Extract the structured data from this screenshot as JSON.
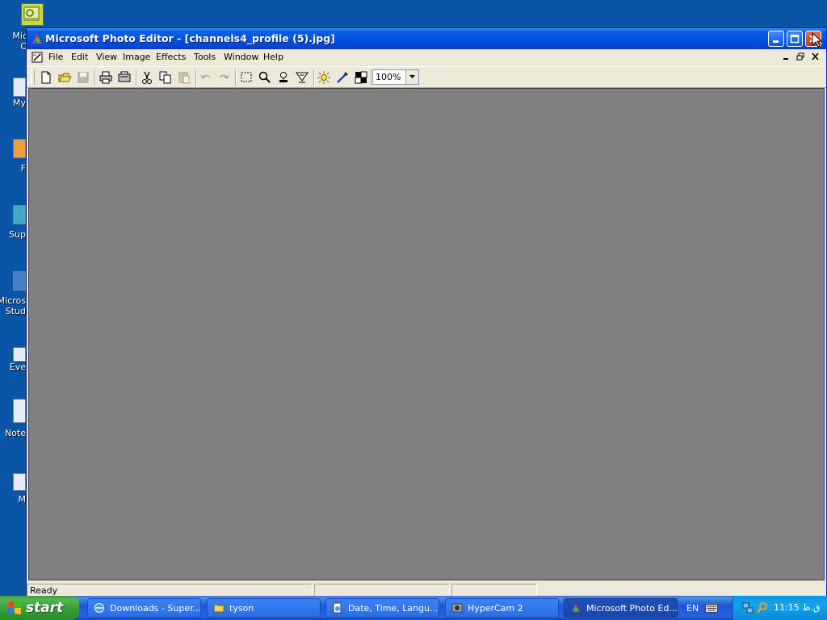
{
  "desktop": {
    "icons": [
      {
        "label": "Mic\nO",
        "name": "outlook"
      },
      {
        "label": "My",
        "name": "my-documents"
      },
      {
        "label": "F",
        "name": "firefox"
      },
      {
        "label": "Sup",
        "name": "super"
      },
      {
        "label": "Micros\nStud",
        "name": "microsoft-studio"
      },
      {
        "label": "Eve",
        "name": "eve"
      },
      {
        "label": "Note",
        "name": "notepad"
      },
      {
        "label": "M",
        "name": "m"
      }
    ]
  },
  "window": {
    "title": "Microsoft Photo Editor - [channels4_profile (5).jpg]",
    "menu": [
      "File",
      "Edit",
      "View",
      "Image",
      "Effects",
      "Tools",
      "Window",
      "Help"
    ],
    "zoom": "100%",
    "status": "Ready"
  },
  "taskbar": {
    "start": "start",
    "tasks": [
      {
        "label": "Downloads - Super...",
        "icon": "ie-icon"
      },
      {
        "label": "tyson",
        "icon": "folder-icon"
      },
      {
        "label": "Date, Time, Langu...",
        "icon": "control-panel-icon"
      },
      {
        "label": "HyperCam 2",
        "icon": "hypercam-icon"
      },
      {
        "label": "Microsoft Photo Ed...",
        "icon": "photo-editor-icon"
      }
    ],
    "language": "EN",
    "clock": "11:15 ق.ظ"
  },
  "colors": {
    "desktop": "#0b55a7",
    "workspace": "#808080",
    "titlebar": "#0054e3",
    "start": "#369e36"
  }
}
